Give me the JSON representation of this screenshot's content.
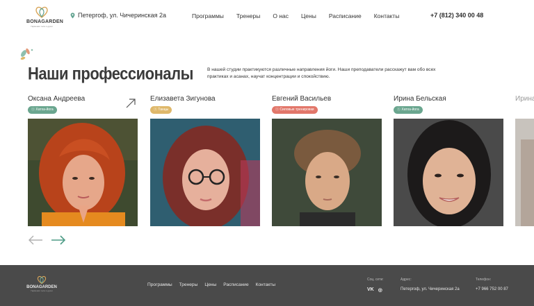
{
  "brand": {
    "name": "BONAGARDEN",
    "tagline": "Гармония тела и души"
  },
  "header": {
    "address": "Петергоф, ул. Чичеринская 2а",
    "nav": [
      "Программы",
      "Тренеры",
      "О нас",
      "Цены",
      "Расписание",
      "Контакты"
    ],
    "phone": "+7 (812) 340 00 48"
  },
  "section": {
    "title": "Наши профессионалы",
    "description": "В нашей студии практикуются различные направления йоги. Наши преподаватели расскажут вам обо всех практиках и асанах, научат концентрации и спокойствию."
  },
  "trainers": [
    {
      "name": "Оксана Андреева",
      "tag": "Хатха-йога",
      "tag_color": "#6aa68f"
    },
    {
      "name": "Елизавета Зигунова",
      "tag": "Танцы",
      "tag_color": "#dfb86a"
    },
    {
      "name": "Евгений Васильев",
      "tag": "Силовые тренировки",
      "tag_color": "#e2776a"
    },
    {
      "name": "Ирина Бельская",
      "tag": "Хатха-йога",
      "tag_color": "#6aa68f"
    },
    {
      "name": "Ирина"
    }
  ],
  "footer": {
    "nav": [
      "Программы",
      "Тренеры",
      "Цены",
      "Расписание",
      "Контакты"
    ],
    "social_label": "Соц. сети:",
    "social": [
      "VK",
      "◎"
    ],
    "address_label": "Адрес:",
    "address": "Петергоф, ул. Чичеринская 2а",
    "phone_label": "Телефон:",
    "phone": "+7 966 752 00 87"
  },
  "colors": {
    "accent": "#5fa18e",
    "footer_bg": "#4a4a4a"
  }
}
